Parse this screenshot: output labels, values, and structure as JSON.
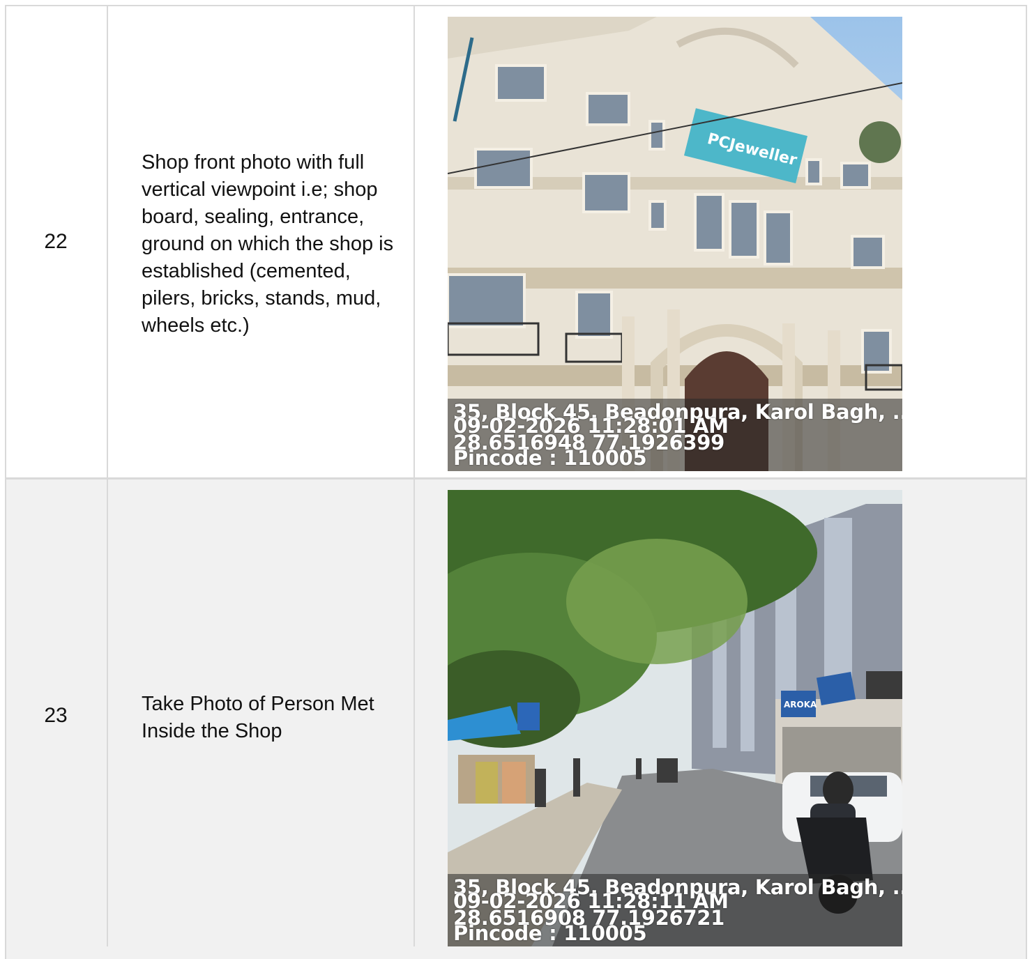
{
  "rows": [
    {
      "number": "22",
      "description": "Shop front photo with full vertical viewpoint i.e; shop board, sealing, entrance, ground on which the shop is established (cemented, pilers, bricks, stands, mud, wheels etc.)",
      "photo": {
        "sign_text": "PCJeweller",
        "stamp": {
          "address": "35, Block 45, Beadonpura, Karol Bagh, ...",
          "datetime": "09-02-2026 11:28:01 AM",
          "coords": "28.6516948 77.1926399",
          "pincode": "Pincode : 110005"
        }
      }
    },
    {
      "number": "23",
      "description": "Take Photo of Person Met Inside the Shop",
      "photo": {
        "sign_text": "AROKA",
        "stamp": {
          "address": "35, Block 45, Beadonpura, Karol Bagh, ...",
          "datetime": "09-02-2026 11:28:11 AM",
          "coords": "28.6516908 77.1926721",
          "pincode": "Pincode : 110005"
        }
      }
    }
  ]
}
